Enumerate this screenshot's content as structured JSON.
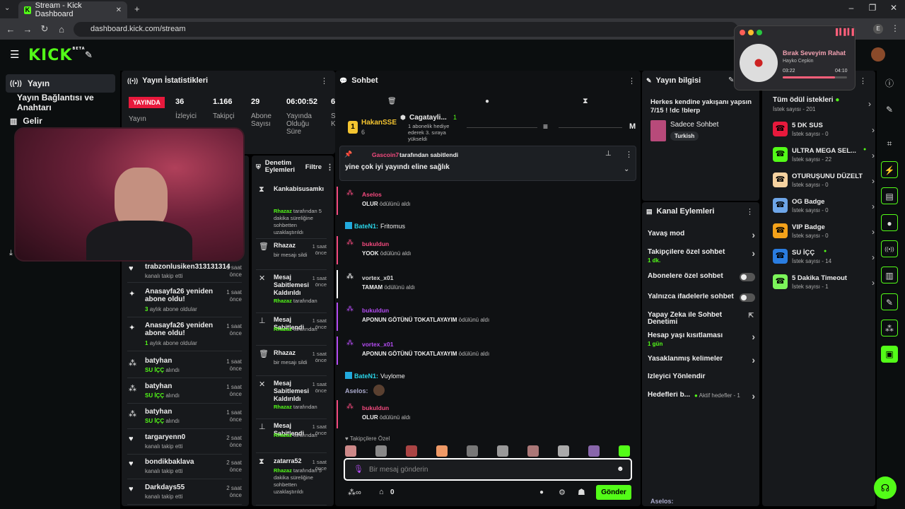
{
  "browser": {
    "tab_title": "Stream - Kick Dashboard",
    "url": "dashboard.kick.com/stream",
    "profile": "E"
  },
  "header": {
    "logo": "KICK",
    "beta": "BETA"
  },
  "sidebar": {
    "items": [
      {
        "label": "Yayın"
      },
      {
        "label": "Yayın Bağlantısı ve Anahtarı"
      },
      {
        "label": "Gelir"
      }
    ]
  },
  "stats": {
    "title": "Yayın İstatistikleri",
    "live_badge": "YAYINDA",
    "items": [
      {
        "value": "36",
        "label": "İzleyici"
      },
      {
        "value": "1.166",
        "label": "Takipçi"
      },
      {
        "value": "29",
        "label": "Abone Sayısı"
      },
      {
        "value": "06:00:52",
        "label": "Yayında Olduğu Süre"
      },
      {
        "value": "6",
        "label": "S K"
      }
    ],
    "yayin_label": "Yayın"
  },
  "feed": [
    {
      "name": "trabzonlusiken313131314",
      "sub": "kanalı takip etti",
      "time": "1 saat önce"
    },
    {
      "name": "Anasayfa26 yeniden abone oldu!",
      "sub_hl": "3",
      "sub": "aylık abone oldular",
      "time": "1 saat önce"
    },
    {
      "name": "Anasayfa26 yeniden abone oldu!",
      "sub_hl": "1",
      "sub": "aylık abone oldular",
      "time": "1 saat önce"
    },
    {
      "name": "batyhan",
      "sub_hl": "SU İÇÇ",
      "sub": "alındı",
      "time": "1 saat önce"
    },
    {
      "name": "batyhan",
      "sub_hl": "SU İÇÇ",
      "sub": "alındı",
      "time": "1 saat önce"
    },
    {
      "name": "batyhan",
      "sub_hl": "SU İÇÇ",
      "sub": "alındı",
      "time": "1 saat önce"
    },
    {
      "name": "targaryenn0",
      "sub": "kanalı takip etti",
      "time": "2 saat önce"
    },
    {
      "name": "bondikbaklava",
      "sub": "kanalı takip etti",
      "time": "2 saat önce"
    },
    {
      "name": "Darkdays55",
      "sub": "kanalı takip etti",
      "time": "2 saat önce"
    }
  ],
  "moderation": {
    "title": "Denetim Eylemleri",
    "filter": "Filtre",
    "items": [
      {
        "icon": "⧗",
        "title": "Kankabisusamkı",
        "desc_hl": "Rhazaz",
        "desc": " tarafından 5 dakika süreliğine sohbetten uzaklaştırıldı",
        "time": ""
      },
      {
        "icon": "🗑",
        "title": "Rhazaz",
        "desc": "bir mesajı sildi",
        "time": "1 saat önce"
      },
      {
        "icon": "✕",
        "title": "Mesaj Sabitlemesi Kaldırıldı",
        "desc_hl": "Rhazaz",
        "desc": " tarafından",
        "time": "1 saat önce"
      },
      {
        "icon": "⊥",
        "title": "Mesaj Sabitlendi",
        "desc_hl": "Rhazaz",
        "desc": " tarafından",
        "time": "1 saat önce"
      },
      {
        "icon": "🗑",
        "title": "Rhazaz",
        "desc": "bir mesajı sildi",
        "time": "1 saat önce"
      },
      {
        "icon": "✕",
        "title": "Mesaj Sabitlemesi Kaldırıldı",
        "desc_hl": "Rhazaz",
        "desc": " tarafından",
        "time": "1 saat önce"
      },
      {
        "icon": "⊥",
        "title": "Mesaj Sabitlendi",
        "desc_hl": "Rhazaz",
        "desc": " tarafından",
        "time": "1 saat önce"
      },
      {
        "icon": "⧗",
        "title": "zatarra52",
        "desc_hl": "Rhazaz",
        "desc": " tarafından 5 dakika süreliğine sohbetten uzaklaştırıldı",
        "time": "1 saat önce"
      }
    ]
  },
  "chat": {
    "title": "Sohbet",
    "gifter1": "HakanSSE",
    "gifter1_count": "6",
    "gifter2": "Cagatayli...",
    "gifter2_count": "1",
    "gift_text": "1 abonelik hediye ederek 3. sıraya yükseldi",
    "m": "M",
    "pinned_by": "Gascoin7",
    "pinned_suffix": "tarafından sabitlendi",
    "pinned_msg": "yine çok iyi yayındı eline sağlık",
    "messages": [
      {
        "type": "redeem",
        "name": "Aselos",
        "color": "#f34a7e",
        "reward": "OLUR",
        "suffix": "ödülünü aldı"
      },
      {
        "type": "chat",
        "name": "BateN1",
        "text": "Fritomus"
      },
      {
        "type": "redeem",
        "name": "bukuldun",
        "color": "#f34a7e",
        "reward": "YOOK",
        "suffix": "ödülünü aldı"
      },
      {
        "type": "redeem",
        "name": "vortex_x01",
        "color": "#ffffff",
        "reward": "TAMAM",
        "suffix": "ödülünü aldı"
      },
      {
        "type": "redeem",
        "name": "bukuldun",
        "color": "#b44cf3",
        "reward": "APONUN GÖTÜNÜ TOKATLAYAYIM",
        "suffix": "ödülünü aldı"
      },
      {
        "type": "redeem",
        "name": "vortex_x01",
        "color": "#b44cf3",
        "reward": "APONUN GÖTÜNÜ TOKATLAYAYIM",
        "suffix": "ödülünü aldı"
      },
      {
        "type": "chat",
        "name": "BateN1",
        "text": "Vuylome"
      },
      {
        "type": "chat",
        "name": "Aselos",
        "text": ""
      },
      {
        "type": "redeem",
        "name": "bukuldun",
        "color": "#f34a7e",
        "reward": "OLUR",
        "suffix": "ödülünü aldı"
      }
    ],
    "followers_only": "Takipçilere Özel",
    "placeholder": "Bir mesaj gönderin",
    "send": "Gönder",
    "points": "0",
    "footer_user": "Aselos:"
  },
  "stream_info": {
    "title": "Yayın bilgisi",
    "stream_title": "Herkes kendine yakışanı yapsın 7/15 ! !dc !blerp",
    "category": "Sadece Sohbet",
    "tag": "Turkish"
  },
  "channel_actions": {
    "title": "Kanal Eylemleri",
    "items": [
      {
        "label": "Yavaş mod",
        "sub": "",
        "control": "chevron"
      },
      {
        "label": "Takipçilere özel sohbet",
        "sub": "1 dk.",
        "control": "chevron"
      },
      {
        "label": "Abonelere özel sohbet",
        "sub": "",
        "control": "toggle"
      },
      {
        "label": "Yalnızca ifadelerle sohbet",
        "sub": "",
        "control": "toggle"
      },
      {
        "label": "Yapay Zeka ile Sohbet Denetimi",
        "sub": "",
        "control": "external"
      },
      {
        "label": "Hesap yaşı kısıtlaması",
        "sub": "1 gün",
        "control": "chevron"
      },
      {
        "label": "Yasaklanmış kelimeler",
        "sub": "",
        "control": "chevron"
      },
      {
        "label": "İzleyici Yönlendir",
        "sub": "",
        "control": "none"
      },
      {
        "label": "Hedefleri b...",
        "sub": "",
        "extra": "Aktif hedefler - 1",
        "control": "chevron"
      }
    ]
  },
  "rewards": {
    "all": "Tüm ödül istekleri",
    "all_sub": "İstek sayısı - 201",
    "items": [
      {
        "name": "5 DK SUS",
        "sub": "İstek sayısı - 0",
        "color": "#e8193c"
      },
      {
        "name": "ULTRA MEGA SEL...",
        "sub": "İstek sayısı - 22",
        "color": "#53fc18"
      },
      {
        "name": "OTURUŞUNU DÜZELT",
        "sub": "İstek sayısı - 0",
        "color": "#f6d2a0"
      },
      {
        "name": "OG Badge",
        "sub": "İstek sayısı - 0",
        "color": "#6ea6e8"
      },
      {
        "name": "VIP Badge",
        "sub": "İstek sayısı - 0",
        "color": "#f4a21a"
      },
      {
        "name": "SU İÇÇ",
        "sub": "İstek sayısı - 14",
        "color": "#2a7de1"
      },
      {
        "name": "5 Dakika Timeout",
        "sub": "İstek sayısı - 1",
        "color": "#7cf55a"
      }
    ]
  },
  "player": {
    "song": "Bırak Seveyim Rahat",
    "artist": "Hayko Cepkin",
    "elapsed": "03:22",
    "total": "04:10",
    "progress": 0.81
  }
}
